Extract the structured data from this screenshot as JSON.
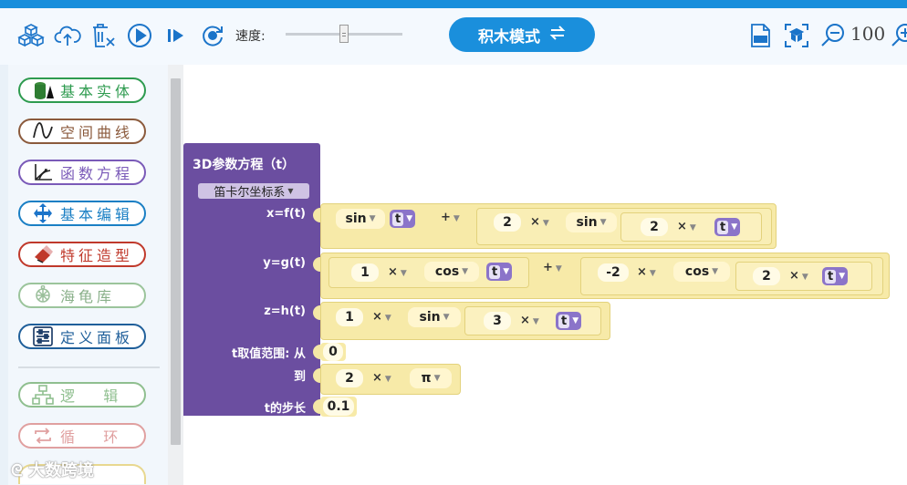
{
  "toolbar": {
    "speed_label": "速度:",
    "speed_value": 0.5,
    "mode_button_label": "积木模式",
    "mode_button_icon": "swap-arrows-icon",
    "zoom_value": "100",
    "icons": [
      "cubes-icon",
      "cloud-upload-icon",
      "clear-trash-icon",
      "play-icon",
      "step-icon",
      "reset-icon",
      "gif-export-icon",
      "focus-icon",
      "zoom-out-icon",
      "zoom-in-icon"
    ]
  },
  "sidebar": {
    "categories": [
      {
        "label": "基本实体",
        "color": "#2e9b4f",
        "icon": "cylinder-icon"
      },
      {
        "label": "空间曲线",
        "color": "#8b5a3c",
        "icon": "curve-icon"
      },
      {
        "label": "函数方程",
        "color": "#7a5ab8",
        "icon": "axes-icon"
      },
      {
        "label": "基本编辑",
        "color": "#1a7fc4",
        "icon": "move-arrows-icon"
      },
      {
        "label": "特征造型",
        "color": "#c0392b",
        "icon": "eraser-icon"
      },
      {
        "label": "海龟库",
        "color": "#9bc49b",
        "icon": "turtle-icon"
      },
      {
        "label": "定义面板",
        "color": "#1f5f9a",
        "icon": "panel-sliders-icon"
      },
      {
        "label": "逻   辑",
        "color": "#8fbf8f",
        "icon": "logic-tree-icon"
      },
      {
        "label": "循   环",
        "color": "#e0a0a0",
        "icon": "loop-icon"
      }
    ]
  },
  "block": {
    "title": "3D参数方程（t）",
    "coord_dropdown": "笛卡尔坐标系",
    "x_label": "x=f(t)",
    "y_label": "y=g(t)",
    "z_label": "z=h(t)",
    "range_from_label": "t取值范围: 从",
    "range_to_label": "到",
    "step_label": "t的步长",
    "x_expr": {
      "fn1": "sin",
      "var1": "t",
      "plus": "+",
      "n2": "2",
      "times1": "×",
      "fn2": "sin",
      "n3": "2",
      "times2": "×",
      "var2": "t"
    },
    "y_expr": {
      "n1": "1",
      "times1": "×",
      "fn1": "cos",
      "var1": "t",
      "plus": "+",
      "n2": "-2",
      "times2": "×",
      "fn2": "cos",
      "n3": "2",
      "times3": "×",
      "var2": "t"
    },
    "z_expr": {
      "n1": "1",
      "times1": "×",
      "fn1": "sin",
      "n2": "3",
      "times2": "×",
      "var1": "t"
    },
    "range_from": "0",
    "range_to": {
      "n1": "2",
      "times": "×",
      "const": "π"
    },
    "step": "0.1"
  },
  "watermark": "大数跨境",
  "colors": {
    "accent": "#1a8fdc",
    "block_purple": "#6b4ea0",
    "block_yellow": "#f7eaa8",
    "var_purple": "#8b74c9"
  }
}
